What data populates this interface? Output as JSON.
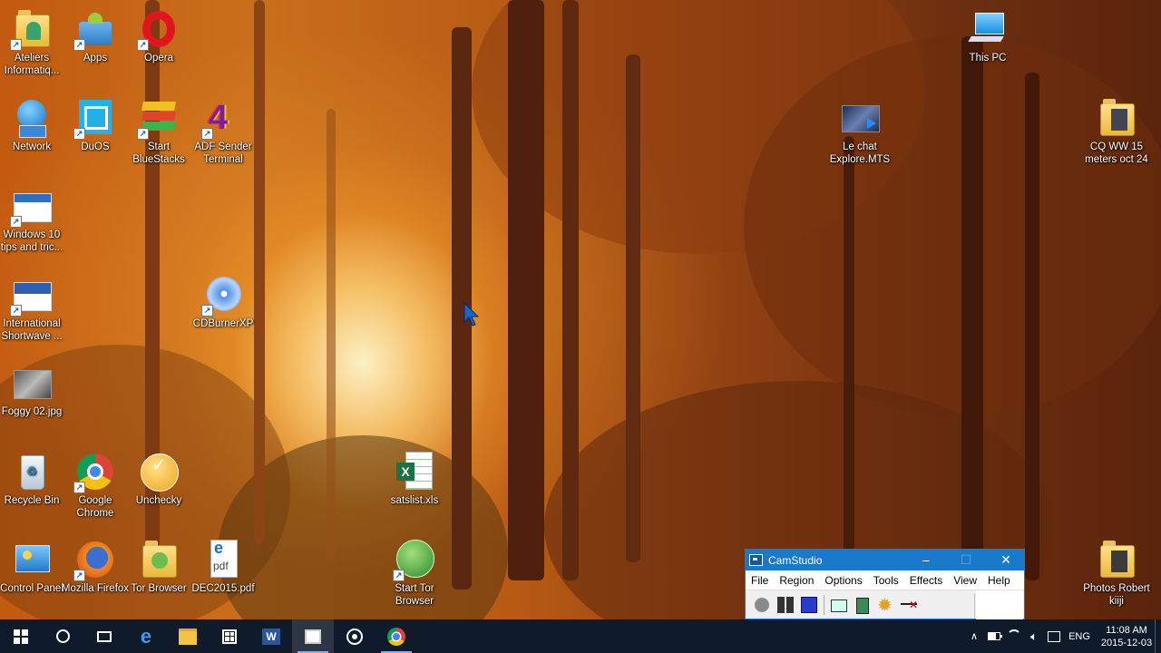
{
  "desktop": {
    "icons": [
      {
        "label": "Ateliers Informatiq...",
        "icon": "folder-user-icon"
      },
      {
        "label": "Apps",
        "icon": "android-apps-icon"
      },
      {
        "label": "Opera",
        "icon": "opera-icon"
      },
      {
        "label": "Network",
        "icon": "network-globe-icon"
      },
      {
        "label": "DuOS",
        "icon": "duos-icon"
      },
      {
        "label": "Start BlueStacks",
        "icon": "bluestacks-icon"
      },
      {
        "label": "ADF Sender Terminal",
        "icon": "adf-sender-icon"
      },
      {
        "label": "Windows 10 tips and tric...",
        "icon": "document-thumb-icon"
      },
      {
        "label": "International Shortwave ...",
        "icon": "document-thumb-icon"
      },
      {
        "label": "CDBurnerXP",
        "icon": "cdburner-icon"
      },
      {
        "label": "Foggy 02.jpg",
        "icon": "image-thumb-icon"
      },
      {
        "label": "Recycle Bin",
        "icon": "recycle-bin-icon"
      },
      {
        "label": "Google Chrome",
        "icon": "chrome-icon"
      },
      {
        "label": "Unchecky",
        "icon": "unchecky-icon"
      },
      {
        "label": "satslist.xls",
        "icon": "excel-file-icon"
      },
      {
        "label": "Control Panel",
        "icon": "control-panel-icon"
      },
      {
        "label": "Mozilla Firefox",
        "icon": "firefox-icon"
      },
      {
        "label": "Tor Browser",
        "icon": "folder-icon"
      },
      {
        "label": "DEC2015.pdf",
        "icon": "pdf-file-icon"
      },
      {
        "label": "Start Tor Browser",
        "icon": "tor-globe-icon"
      },
      {
        "label": "This PC",
        "icon": "this-pc-icon"
      },
      {
        "label": "Le chat Explore.MTS",
        "icon": "video-file-icon"
      },
      {
        "label": "CQ WW 15 meters oct 24",
        "icon": "folder-icon"
      },
      {
        "label": "Photos Robert kiiji",
        "icon": "folder-icon"
      }
    ]
  },
  "camstudio": {
    "title": "CamStudio",
    "minimize": "–",
    "maximize": "☐",
    "close": "✕",
    "menu": [
      "File",
      "Region",
      "Options",
      "Tools",
      "Effects",
      "View",
      "Help"
    ]
  },
  "taskbar": {
    "items": [
      "start-windows-icon",
      "cortana-circle-icon",
      "task-view-icon",
      "edge-icon",
      "file-explorer-icon",
      "store-icon",
      "word-icon",
      "camstudio-icon",
      "groove-icon",
      "chrome-icon"
    ],
    "tray": {
      "chevron": "∧",
      "language": "ENG",
      "time": "11:08 AM",
      "date": "2015-12-03"
    }
  }
}
